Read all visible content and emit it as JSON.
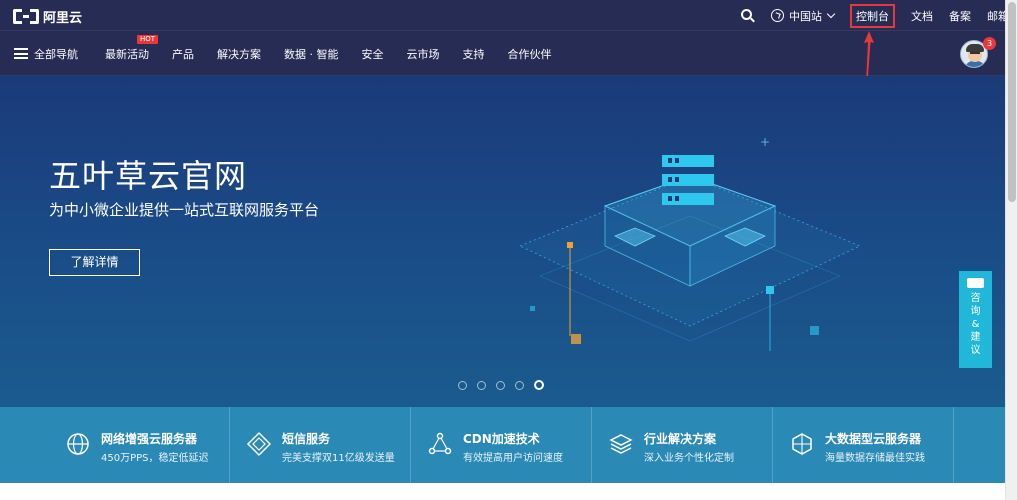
{
  "header": {
    "logo_text": "阿里云",
    "links": [
      "文档",
      "备案",
      "邮箱"
    ],
    "region_label": "中国站",
    "console_label": "控制台"
  },
  "nav": {
    "all_nav_label": "全部导航",
    "items": [
      "最新活动",
      "产品",
      "解决方案",
      "数据 · 智能",
      "安全",
      "云市场",
      "支持",
      "合作伙伴"
    ],
    "hot_badge": "HOT",
    "avatar_badge_count": "3"
  },
  "hero": {
    "title": "五叶草云官网",
    "subtitle": "为中小微企业提供一站式互联网服务平台",
    "button_label": "了解详情",
    "carousel": {
      "total": 5,
      "active_index": 4
    }
  },
  "side_widget": {
    "label_chars": [
      "咨",
      "询",
      "&",
      "建",
      "议"
    ]
  },
  "features": [
    {
      "title": "网络增强云服务器",
      "desc": "450万PPS，稳定低延迟",
      "icon": "network-globe-icon"
    },
    {
      "title": "短信服务",
      "desc": "完美支撑双11亿级发送量",
      "icon": "message-diamond-icon"
    },
    {
      "title": "CDN加速技术",
      "desc": "有效提高用户访问速度",
      "icon": "cdn-nodes-icon"
    },
    {
      "title": "行业解决方案",
      "desc": "深入业务个性化定制",
      "icon": "solution-layers-icon"
    },
    {
      "title": "大数据型云服务器",
      "desc": "海量数据存储最佳实践",
      "icon": "bigdata-server-icon"
    }
  ],
  "colors": {
    "header_bg": "#262c54",
    "hero_bg": "#1b3a78",
    "feature_bar_bg": "#2b89b5",
    "accent_red": "#e8383a",
    "consult_cyan": "#21b7d9"
  }
}
